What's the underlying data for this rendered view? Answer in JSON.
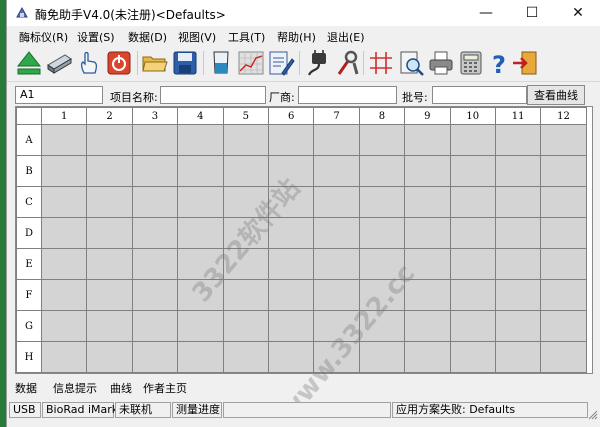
{
  "window": {
    "title": "酶免助手V4.0(未注册)<Defaults>",
    "controls": {
      "minimize": "—",
      "maximize": "☐",
      "close": "✕"
    }
  },
  "menu": [
    "酶标仪(R)",
    "设置(S)",
    "数据(D)",
    "视图(V)",
    "工具(T)",
    "帮助(H)",
    "退出(E)"
  ],
  "toolbar": {
    "icons": [
      "eject-up-icon",
      "scanner-icon",
      "hand-pointer-icon",
      "power-icon",
      "open-folder-icon",
      "save-disk-icon",
      "beaker-icon",
      "chart-grid-icon",
      "edit-document-icon",
      "plug-icon",
      "tools-icon",
      "grid-hash-icon",
      "print-preview-icon",
      "printer-icon",
      "calculator-icon",
      "help-icon",
      "exit-door-icon"
    ]
  },
  "info": {
    "well_value": "A1",
    "project_label": "项目名称:",
    "project_value": "",
    "vendor_label": "厂商:",
    "vendor_value": "",
    "batch_label": "批号:",
    "batch_value": "",
    "curve_button": "查看曲线"
  },
  "plate": {
    "columns": [
      "1",
      "2",
      "3",
      "4",
      "5",
      "6",
      "7",
      "8",
      "9",
      "10",
      "11",
      "12"
    ],
    "rows": [
      "A",
      "B",
      "C",
      "D",
      "E",
      "F",
      "G",
      "H"
    ]
  },
  "tabs": [
    "数据",
    "信息提示",
    "曲线",
    "作者主页"
  ],
  "active_tab": "数据",
  "status": {
    "port": "USB",
    "device": "BioRad iMark",
    "connection": "未联机",
    "progress_label": "测量进度",
    "progress_value": 0,
    "message": "应用方案失败: Defaults"
  },
  "watermark": {
    "text1": "3322软件站",
    "text2": "www.3322.cc"
  },
  "colors": {
    "cell_fill": "#d4d4d4",
    "window_bg": "#f0f0f0",
    "desktop": "#2a7a3a"
  }
}
